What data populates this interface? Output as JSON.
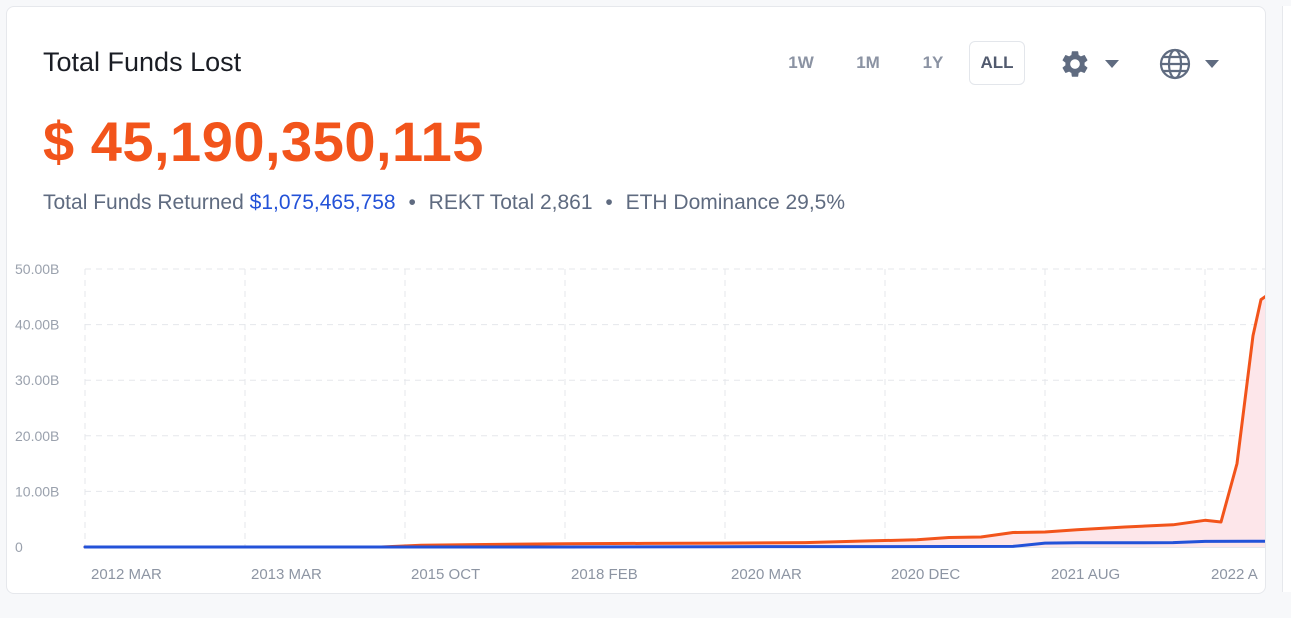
{
  "header": {
    "title": "Total Funds Lost",
    "ranges": [
      {
        "label": "1W",
        "active": false
      },
      {
        "label": "1M",
        "active": false
      },
      {
        "label": "1Y",
        "active": false
      },
      {
        "label": "ALL",
        "active": true
      }
    ],
    "settings_icon": "gear-icon",
    "language_icon": "globe-icon",
    "dropdown_icon": "caret-down-icon"
  },
  "summary": {
    "total_lost": "$ 45,190,350,115",
    "returned_label": "Total Funds Returned",
    "returned_value": "$1,075,465,758",
    "separator": "•",
    "rekt_label": "REKT Total",
    "rekt_value": "2,861",
    "eth_label": "ETH Dominance",
    "eth_value": "29,5%"
  },
  "colors": {
    "lost_line": "#f2541b",
    "lost_fill": "#fde6ea",
    "returned_line": "#2352d8",
    "grid": "#e5e7eb",
    "axis_text": "#9aa1ad"
  },
  "chart_data": {
    "type": "line",
    "title": "",
    "xlabel": "",
    "ylabel": "",
    "ylim": [
      0,
      50000000000
    ],
    "y_ticks": [
      0,
      10000000000,
      20000000000,
      30000000000,
      40000000000,
      50000000000
    ],
    "y_tick_labels": [
      "0",
      "10.00B",
      "20.00B",
      "30.00B",
      "40.00B",
      "50.00B"
    ],
    "categories": [
      "2012 MAR",
      "2013 MAR",
      "2015 OCT",
      "2018 FEB",
      "2020 MAR",
      "2020 DEC",
      "2021 AUG",
      "2022 A"
    ],
    "category_pos": [
      0.0,
      1.0,
      2.0,
      3.0,
      4.0,
      5.0,
      6.0,
      7.0
    ],
    "grid": true,
    "legend": "none",
    "series": [
      {
        "color": "#f2541b",
        "fill": true,
        "x": [
          0,
          1,
          1.85,
          2.1,
          2.5,
          3.0,
          3.5,
          4.0,
          4.5,
          4.9,
          5.2,
          5.4,
          5.6,
          5.8,
          6.0,
          6.2,
          6.5,
          6.8,
          7.0,
          7.1,
          7.2,
          7.3,
          7.35,
          7.4,
          7.5,
          7.6,
          7.68
        ],
        "y": [
          0,
          0,
          0,
          300000000,
          450000000,
          600000000,
          650000000,
          700000000,
          800000000,
          1100000000,
          1300000000,
          1700000000,
          1800000000,
          2600000000,
          2700000000,
          3100000000,
          3600000000,
          4000000000,
          4800000000,
          4500000000,
          15000000000,
          38000000000,
          44500000000,
          45500000000,
          45000000000,
          45100000000,
          45190350115
        ]
      },
      {
        "color": "#2352d8",
        "fill": false,
        "x": [
          0,
          1,
          2,
          3,
          4,
          5,
          5.8,
          6.0,
          6.2,
          6.5,
          6.8,
          7.0,
          7.3,
          7.68
        ],
        "y": [
          0,
          0,
          0,
          0,
          50000000,
          80000000,
          100000000,
          700000000,
          750000000,
          750000000,
          800000000,
          1000000000,
          1020000000,
          1075465758
        ]
      }
    ]
  }
}
